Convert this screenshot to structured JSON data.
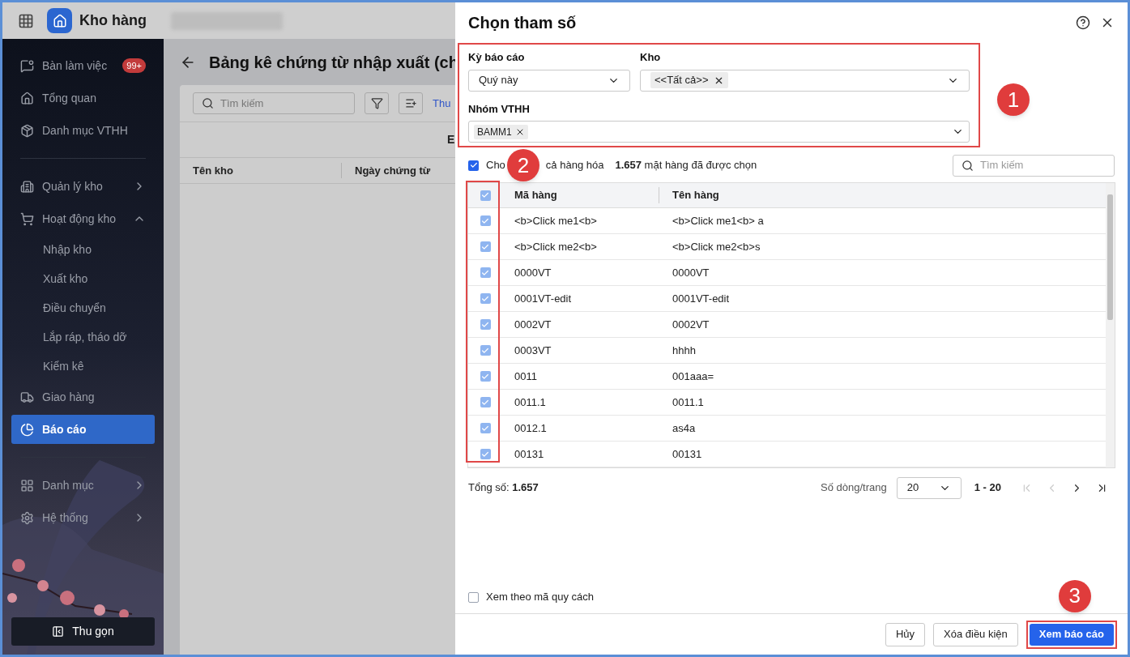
{
  "app": {
    "title": "Kho hàng"
  },
  "sidebar": {
    "items": [
      {
        "kind": "item",
        "label": "Bàn làm việc",
        "badge": "99+",
        "selected": false
      },
      {
        "kind": "item",
        "label": "Tổng quan",
        "selected": false
      },
      {
        "kind": "item",
        "label": "Danh mục VTHH",
        "selected": false
      },
      {
        "kind": "divider"
      },
      {
        "kind": "group",
        "label": "Quản lý kho",
        "expanded": false,
        "selected": false
      },
      {
        "kind": "group",
        "label": "Hoạt động kho",
        "expanded": true,
        "selected": false,
        "children": [
          {
            "label": "Nhập kho"
          },
          {
            "label": "Xuất kho"
          },
          {
            "label": "Điều chuyển"
          },
          {
            "label": "Lắp ráp, tháo dỡ"
          },
          {
            "label": "Kiểm kê"
          }
        ]
      },
      {
        "kind": "item",
        "label": "Giao hàng",
        "selected": false
      },
      {
        "kind": "item",
        "label": "Báo cáo",
        "selected": true
      },
      {
        "kind": "divider"
      },
      {
        "kind": "group",
        "label": "Danh mục",
        "expanded": false,
        "selected": false
      },
      {
        "kind": "group",
        "label": "Hệ thống",
        "expanded": false,
        "selected": false
      }
    ],
    "collapse_button": "Thu gọn"
  },
  "page": {
    "title": "Bảng kê chứng từ nhập xuất (ch",
    "search": {
      "placeholder": "Tìm kiếm"
    },
    "link": "Thu",
    "columns": [
      "Tên kho",
      "Ngày chứng từ"
    ],
    "partial_heading": "E"
  },
  "dialog": {
    "title": "Chọn tham số",
    "period": {
      "label": "Kỳ báo cáo",
      "value": "Quý này"
    },
    "warehouse": {
      "label": "Kho",
      "tags": [
        "<<Tất cả>>"
      ]
    },
    "group": {
      "label": "Nhóm VTHH",
      "tags": [
        "BAMM1"
      ]
    },
    "select_all": {
      "label_parts": [
        "Cho",
        "cả hàng hóa"
      ],
      "checked": true,
      "count": "1.657",
      "count_text": "mặt hàng đã được chọn"
    },
    "search": {
      "placeholder": "Tìm kiếm"
    },
    "table": {
      "header_checked": true,
      "columns": [
        "Mã hàng",
        "Tên hàng"
      ],
      "rows": [
        {
          "checked": true,
          "code": "<b>Click me1<b>",
          "name": "<b>Click me1<b> a"
        },
        {
          "checked": true,
          "code": "<b>Click me2<b>",
          "name": "<b>Click me2<b>s"
        },
        {
          "checked": true,
          "code": "0000VT",
          "name": "0000VT"
        },
        {
          "checked": true,
          "code": "0001VT-edit",
          "name": "0001VT-edit"
        },
        {
          "checked": true,
          "code": "0002VT",
          "name": "0002VT"
        },
        {
          "checked": true,
          "code": "0003VT",
          "name": "hhhh"
        },
        {
          "checked": true,
          "code": "0011",
          "name": "001aaa="
        },
        {
          "checked": true,
          "code": "0011.1",
          "name": "0011.1"
        },
        {
          "checked": true,
          "code": "0012.1",
          "name": "as4a"
        },
        {
          "checked": true,
          "code": "00131",
          "name": "00131"
        }
      ]
    },
    "total": {
      "label": "Tổng số:",
      "value": "1.657"
    },
    "pagination": {
      "rows_label": "Số dòng/trang",
      "page_size": "20",
      "range": "1 - 20",
      "first_disabled": true,
      "prev_disabled": true,
      "next_disabled": false,
      "last_disabled": false
    },
    "spec_option": {
      "label": "Xem theo mã quy cách",
      "checked": false
    },
    "buttons": [
      {
        "kind": "secondary",
        "label": "Hủy"
      },
      {
        "kind": "secondary",
        "label": "Xóa điều kiện"
      },
      {
        "kind": "primary",
        "label": "Xem báo cáo"
      }
    ]
  },
  "callouts": [
    "1",
    "2",
    "3"
  ]
}
